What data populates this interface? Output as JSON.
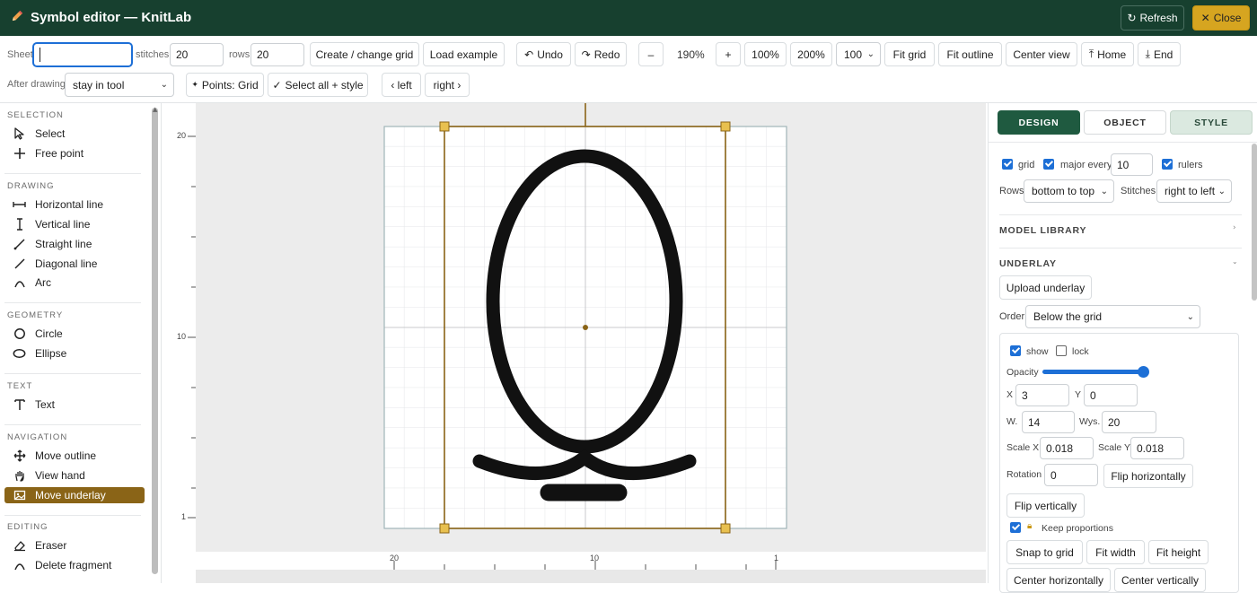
{
  "app": {
    "title": "Symbol editor — KnitLab",
    "refresh_label": "Refresh",
    "close_label": "Close"
  },
  "toolbar1": {
    "sheet_label": "Sheet",
    "sheet_value": "",
    "stitches_label": "stitches",
    "stitches_value": "20",
    "rows_label": "rows",
    "rows_value": "20",
    "create_grid": "Create / change grid",
    "load_example": "Load example",
    "undo": "Undo",
    "redo": "Redo",
    "zoom_out": "–",
    "zoom_level": "190%",
    "zoom_in": "+",
    "zoom_100": "100%",
    "zoom_200": "200%",
    "zoom_select": "100",
    "fit_grid": "Fit grid",
    "fit_outline": "Fit outline",
    "center_view": "Center view",
    "home": "Home",
    "end": "End"
  },
  "toolbar2": {
    "after_drawing_label": "After drawing",
    "after_drawing_value": "stay in tool",
    "points_grid": "Points: Grid",
    "select_all_style": "Select all + style",
    "left": "‹ left",
    "right": "right ›"
  },
  "sidebar": {
    "selection_title": "SELECTION",
    "select": "Select",
    "free_point": "Free point",
    "drawing_title": "DRAWING",
    "horizontal_line": "Horizontal line",
    "vertical_line": "Vertical line",
    "straight_line": "Straight line",
    "diagonal_line": "Diagonal line",
    "arc": "Arc",
    "geometry_title": "GEOMETRY",
    "circle": "Circle",
    "ellipse": "Ellipse",
    "text_title": "TEXT",
    "text": "Text",
    "navigation_title": "NAVIGATION",
    "move_outline": "Move outline",
    "view_hand": "View hand",
    "move_underlay": "Move underlay",
    "editing_title": "EDITING",
    "eraser": "Eraser",
    "delete_fragment": "Delete fragment"
  },
  "rulers": {
    "v_top": "20",
    "v_mid": "10",
    "v_bottom": "1",
    "h_left": "20",
    "h_mid": "10",
    "h_right": "1"
  },
  "right_panel": {
    "tab_design": "DESIGN",
    "tab_object": "OBJECT",
    "tab_style": "STYLE",
    "grid_label": "grid",
    "major_every_label": "major every",
    "major_every_value": "10",
    "rulers_label": "rulers",
    "rows_label": "Rows",
    "rows_value": "bottom to top",
    "stitches_label": "Stitches",
    "stitches_value": "right to left",
    "model_library": "MODEL LIBRARY",
    "underlay_title": "UNDERLAY",
    "upload_underlay": "Upload underlay",
    "order_label": "Order",
    "order_value": "Below the grid",
    "show_label": "show",
    "lock_label": "lock",
    "opacity_label": "Opacity",
    "opacity": 0.95,
    "x_label": "X",
    "x_value": "3",
    "y_label": "Y",
    "y_value": "0",
    "w_label": "W.",
    "w_value": "14",
    "h_label": "Wys.",
    "h_value": "20",
    "scale_x_label": "Scale X",
    "scale_x_value": "0.018",
    "scale_y_label": "Scale Y",
    "scale_y_value": "0.018",
    "rotation_label": "Rotation",
    "rotation_value": "0",
    "flip_h": "Flip horizontally",
    "flip_v": "Flip vertically",
    "keep_proportions": "Keep proportions",
    "snap_to_grid": "Snap to grid",
    "fit_width": "Fit width",
    "fit_height": "Fit height",
    "center_h": "Center horizontally",
    "center_v": "Center vertically"
  },
  "colors": {
    "header_bg": "#17402f",
    "accent_gold": "#d6a520",
    "active_tool": "#8a6417",
    "checkbox": "#1d6fd6",
    "outline": "#8a6417"
  }
}
